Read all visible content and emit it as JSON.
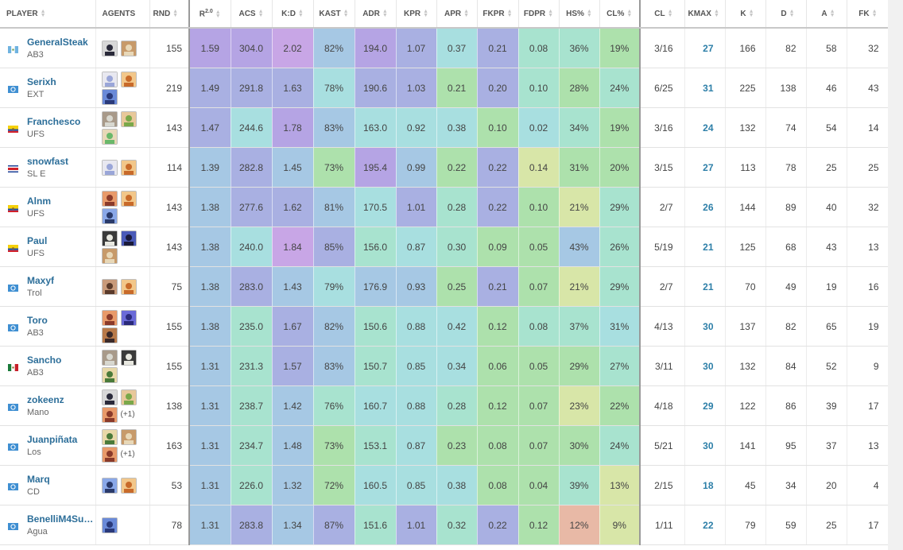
{
  "columns": [
    {
      "label": "PLAYER",
      "sortable": true
    },
    {
      "label": "AGENTS",
      "sortable": false
    },
    {
      "label": "RND",
      "sortable": true
    },
    {
      "label": "R",
      "sup": "2.0",
      "sortable": true
    },
    {
      "label": "ACS",
      "sortable": true
    },
    {
      "label": "K:D",
      "sortable": true
    },
    {
      "label": "KAST",
      "sortable": true
    },
    {
      "label": "ADR",
      "sortable": true
    },
    {
      "label": "KPR",
      "sortable": true
    },
    {
      "label": "APR",
      "sortable": true
    },
    {
      "label": "FKPR",
      "sortable": true
    },
    {
      "label": "FDPR",
      "sortable": true
    },
    {
      "label": "HS%",
      "sortable": true
    },
    {
      "label": "CL%",
      "sortable": true
    },
    {
      "label": "CL",
      "sortable": true
    },
    {
      "label": "KMAX",
      "sortable": true
    },
    {
      "label": "K",
      "sortable": true
    },
    {
      "label": "D",
      "sortable": true
    },
    {
      "label": "A",
      "sortable": true
    },
    {
      "label": "FK",
      "sortable": true
    }
  ],
  "heat_colors": {
    "purple": "#c8a6e6",
    "violet": "#b5a4e4",
    "indigo": "#a9b0e2",
    "blue": "#a6c8e4",
    "cyan": "#a8dfe0",
    "teal": "#a8e3cf",
    "green": "#ade1ac",
    "lime": "#d8e6a8",
    "salmon": "#e8b9a6"
  },
  "rows": [
    {
      "flag": "gt",
      "name": "GeneralSteak",
      "team": "AB3",
      "agents": [
        "ag-1",
        "ag-2"
      ],
      "extra": "",
      "rnd": "155",
      "heat": [
        [
          "1.59",
          "violet"
        ],
        [
          "304.0",
          "violet"
        ],
        [
          "2.02",
          "purple"
        ],
        [
          "82%",
          "blue"
        ],
        [
          "194.0",
          "violet"
        ],
        [
          "1.07",
          "indigo"
        ],
        [
          "0.37",
          "cyan"
        ],
        [
          "0.21",
          "indigo"
        ],
        [
          "0.08",
          "teal"
        ],
        [
          "36%",
          "teal"
        ],
        [
          "19%",
          "green"
        ]
      ],
      "cl": "3/16",
      "kmax": "27",
      "k": "166",
      "d": "82",
      "a": "58",
      "fk": "32"
    },
    {
      "flag": "un",
      "name": "Serixh",
      "team": "EXT",
      "agents": [
        "ag-3",
        "ag-4",
        "ag-5"
      ],
      "extra": "",
      "rnd": "219",
      "heat": [
        [
          "1.49",
          "indigo"
        ],
        [
          "291.8",
          "indigo"
        ],
        [
          "1.63",
          "indigo"
        ],
        [
          "78%",
          "cyan"
        ],
        [
          "190.6",
          "indigo"
        ],
        [
          "1.03",
          "indigo"
        ],
        [
          "0.21",
          "green"
        ],
        [
          "0.20",
          "indigo"
        ],
        [
          "0.10",
          "teal"
        ],
        [
          "28%",
          "green"
        ],
        [
          "24%",
          "teal"
        ]
      ],
      "cl": "6/25",
      "kmax": "31",
      "k": "225",
      "d": "138",
      "a": "46",
      "fk": "43"
    },
    {
      "flag": "ec",
      "name": "Franchesco",
      "team": "UFS",
      "agents": [
        "ag-6",
        "ag-7",
        "ag-8"
      ],
      "extra": "",
      "rnd": "143",
      "heat": [
        [
          "1.47",
          "indigo"
        ],
        [
          "244.6",
          "cyan"
        ],
        [
          "1.78",
          "violet"
        ],
        [
          "83%",
          "blue"
        ],
        [
          "163.0",
          "cyan"
        ],
        [
          "0.92",
          "cyan"
        ],
        [
          "0.38",
          "cyan"
        ],
        [
          "0.10",
          "green"
        ],
        [
          "0.02",
          "cyan"
        ],
        [
          "34%",
          "teal"
        ],
        [
          "19%",
          "green"
        ]
      ],
      "cl": "3/16",
      "kmax": "24",
      "k": "132",
      "d": "74",
      "a": "54",
      "fk": "14"
    },
    {
      "flag": "cr",
      "name": "snowfast",
      "team": "SL E",
      "agents": [
        "ag-3",
        "ag-4"
      ],
      "extra": "",
      "rnd": "114",
      "heat": [
        [
          "1.39",
          "blue"
        ],
        [
          "282.8",
          "indigo"
        ],
        [
          "1.45",
          "blue"
        ],
        [
          "73%",
          "green"
        ],
        [
          "195.4",
          "violet"
        ],
        [
          "0.99",
          "blue"
        ],
        [
          "0.22",
          "green"
        ],
        [
          "0.22",
          "indigo"
        ],
        [
          "0.14",
          "lime"
        ],
        [
          "31%",
          "green"
        ],
        [
          "20%",
          "green"
        ]
      ],
      "cl": "3/15",
      "kmax": "27",
      "k": "113",
      "d": "78",
      "a": "25",
      "fk": "25"
    },
    {
      "flag": "ec",
      "name": "Alnm",
      "team": "UFS",
      "agents": [
        "ag-9",
        "ag-4",
        "ag-10"
      ],
      "extra": "",
      "rnd": "143",
      "heat": [
        [
          "1.38",
          "blue"
        ],
        [
          "277.6",
          "indigo"
        ],
        [
          "1.62",
          "indigo"
        ],
        [
          "81%",
          "blue"
        ],
        [
          "170.5",
          "cyan"
        ],
        [
          "1.01",
          "indigo"
        ],
        [
          "0.28",
          "teal"
        ],
        [
          "0.22",
          "indigo"
        ],
        [
          "0.10",
          "green"
        ],
        [
          "21%",
          "lime"
        ],
        [
          "29%",
          "teal"
        ]
      ],
      "cl": "2/7",
      "kmax": "26",
      "k": "144",
      "d": "89",
      "a": "40",
      "fk": "32"
    },
    {
      "flag": "ec",
      "name": "Paul",
      "team": "UFS",
      "agents": [
        "ag-11",
        "ag-12",
        "ag-2"
      ],
      "extra": "",
      "rnd": "143",
      "heat": [
        [
          "1.38",
          "blue"
        ],
        [
          "240.0",
          "cyan"
        ],
        [
          "1.84",
          "purple"
        ],
        [
          "85%",
          "indigo"
        ],
        [
          "156.0",
          "teal"
        ],
        [
          "0.87",
          "cyan"
        ],
        [
          "0.30",
          "teal"
        ],
        [
          "0.09",
          "green"
        ],
        [
          "0.05",
          "green"
        ],
        [
          "43%",
          "blue"
        ],
        [
          "26%",
          "teal"
        ]
      ],
      "cl": "5/19",
      "kmax": "21",
      "k": "125",
      "d": "68",
      "a": "43",
      "fk": "13"
    },
    {
      "flag": "un",
      "name": "Maxyf",
      "team": "Trol",
      "agents": [
        "ag-13",
        "ag-4"
      ],
      "extra": "",
      "rnd": "75",
      "heat": [
        [
          "1.38",
          "blue"
        ],
        [
          "283.0",
          "indigo"
        ],
        [
          "1.43",
          "blue"
        ],
        [
          "79%",
          "cyan"
        ],
        [
          "176.9",
          "blue"
        ],
        [
          "0.93",
          "blue"
        ],
        [
          "0.25",
          "green"
        ],
        [
          "0.21",
          "indigo"
        ],
        [
          "0.07",
          "green"
        ],
        [
          "21%",
          "lime"
        ],
        [
          "29%",
          "teal"
        ]
      ],
      "cl": "2/7",
      "kmax": "21",
      "k": "70",
      "d": "49",
      "a": "19",
      "fk": "16"
    },
    {
      "flag": "un",
      "name": "Toro",
      "team": "AB3",
      "agents": [
        "ag-9",
        "ag-14",
        "ag-15"
      ],
      "extra": "",
      "rnd": "155",
      "heat": [
        [
          "1.38",
          "blue"
        ],
        [
          "235.0",
          "teal"
        ],
        [
          "1.67",
          "indigo"
        ],
        [
          "82%",
          "blue"
        ],
        [
          "150.6",
          "teal"
        ],
        [
          "0.88",
          "cyan"
        ],
        [
          "0.42",
          "cyan"
        ],
        [
          "0.12",
          "green"
        ],
        [
          "0.08",
          "teal"
        ],
        [
          "37%",
          "teal"
        ],
        [
          "31%",
          "cyan"
        ]
      ],
      "cl": "4/13",
      "kmax": "30",
      "k": "137",
      "d": "82",
      "a": "65",
      "fk": "19"
    },
    {
      "flag": "mx",
      "name": "Sancho",
      "team": "AB3",
      "agents": [
        "ag-6",
        "ag-11",
        "ag-16"
      ],
      "extra": "",
      "rnd": "155",
      "heat": [
        [
          "1.31",
          "blue"
        ],
        [
          "231.3",
          "teal"
        ],
        [
          "1.57",
          "indigo"
        ],
        [
          "83%",
          "blue"
        ],
        [
          "150.7",
          "teal"
        ],
        [
          "0.85",
          "cyan"
        ],
        [
          "0.34",
          "cyan"
        ],
        [
          "0.06",
          "green"
        ],
        [
          "0.05",
          "green"
        ],
        [
          "29%",
          "green"
        ],
        [
          "27%",
          "teal"
        ]
      ],
      "cl": "3/11",
      "kmax": "30",
      "k": "132",
      "d": "84",
      "a": "52",
      "fk": "9"
    },
    {
      "flag": "un",
      "name": "zokeenz",
      "team": "Mano",
      "agents": [
        "ag-1",
        "ag-7",
        "ag-9"
      ],
      "extra": "(+1)",
      "rnd": "138",
      "heat": [
        [
          "1.31",
          "blue"
        ],
        [
          "238.7",
          "teal"
        ],
        [
          "1.42",
          "blue"
        ],
        [
          "76%",
          "teal"
        ],
        [
          "160.7",
          "cyan"
        ],
        [
          "0.88",
          "cyan"
        ],
        [
          "0.28",
          "teal"
        ],
        [
          "0.12",
          "green"
        ],
        [
          "0.07",
          "green"
        ],
        [
          "23%",
          "lime"
        ],
        [
          "22%",
          "green"
        ]
      ],
      "cl": "4/18",
      "kmax": "29",
      "k": "122",
      "d": "86",
      "a": "39",
      "fk": "17"
    },
    {
      "flag": "un",
      "name": "Juanpiñata",
      "team": "Los",
      "agents": [
        "ag-16",
        "ag-2",
        "ag-9"
      ],
      "extra": "(+1)",
      "rnd": "163",
      "heat": [
        [
          "1.31",
          "blue"
        ],
        [
          "234.7",
          "teal"
        ],
        [
          "1.48",
          "blue"
        ],
        [
          "73%",
          "green"
        ],
        [
          "153.1",
          "teal"
        ],
        [
          "0.87",
          "cyan"
        ],
        [
          "0.23",
          "green"
        ],
        [
          "0.08",
          "green"
        ],
        [
          "0.07",
          "green"
        ],
        [
          "30%",
          "green"
        ],
        [
          "24%",
          "teal"
        ]
      ],
      "cl": "5/21",
      "kmax": "30",
      "k": "141",
      "d": "95",
      "a": "37",
      "fk": "13"
    },
    {
      "flag": "un",
      "name": "Marq",
      "team": "CD",
      "agents": [
        "ag-10",
        "ag-4"
      ],
      "extra": "",
      "rnd": "53",
      "heat": [
        [
          "1.31",
          "blue"
        ],
        [
          "226.0",
          "teal"
        ],
        [
          "1.32",
          "blue"
        ],
        [
          "72%",
          "green"
        ],
        [
          "160.5",
          "cyan"
        ],
        [
          "0.85",
          "cyan"
        ],
        [
          "0.38",
          "cyan"
        ],
        [
          "0.08",
          "green"
        ],
        [
          "0.04",
          "green"
        ],
        [
          "39%",
          "teal"
        ],
        [
          "13%",
          "lime"
        ]
      ],
      "cl": "2/15",
      "kmax": "18",
      "k": "45",
      "d": "34",
      "a": "20",
      "fk": "4"
    },
    {
      "flag": "un",
      "name": "BenelliM4Sup...",
      "team": "Agua",
      "agents": [
        "ag-5"
      ],
      "extra": "",
      "rnd": "78",
      "heat": [
        [
          "1.31",
          "blue"
        ],
        [
          "283.8",
          "indigo"
        ],
        [
          "1.34",
          "blue"
        ],
        [
          "87%",
          "indigo"
        ],
        [
          "151.6",
          "teal"
        ],
        [
          "1.01",
          "indigo"
        ],
        [
          "0.32",
          "teal"
        ],
        [
          "0.22",
          "indigo"
        ],
        [
          "0.12",
          "green"
        ],
        [
          "12%",
          "salmon"
        ],
        [
          "9%",
          "lime"
        ]
      ],
      "cl": "1/11",
      "kmax": "22",
      "k": "79",
      "d": "59",
      "a": "25",
      "fk": "17"
    }
  ]
}
